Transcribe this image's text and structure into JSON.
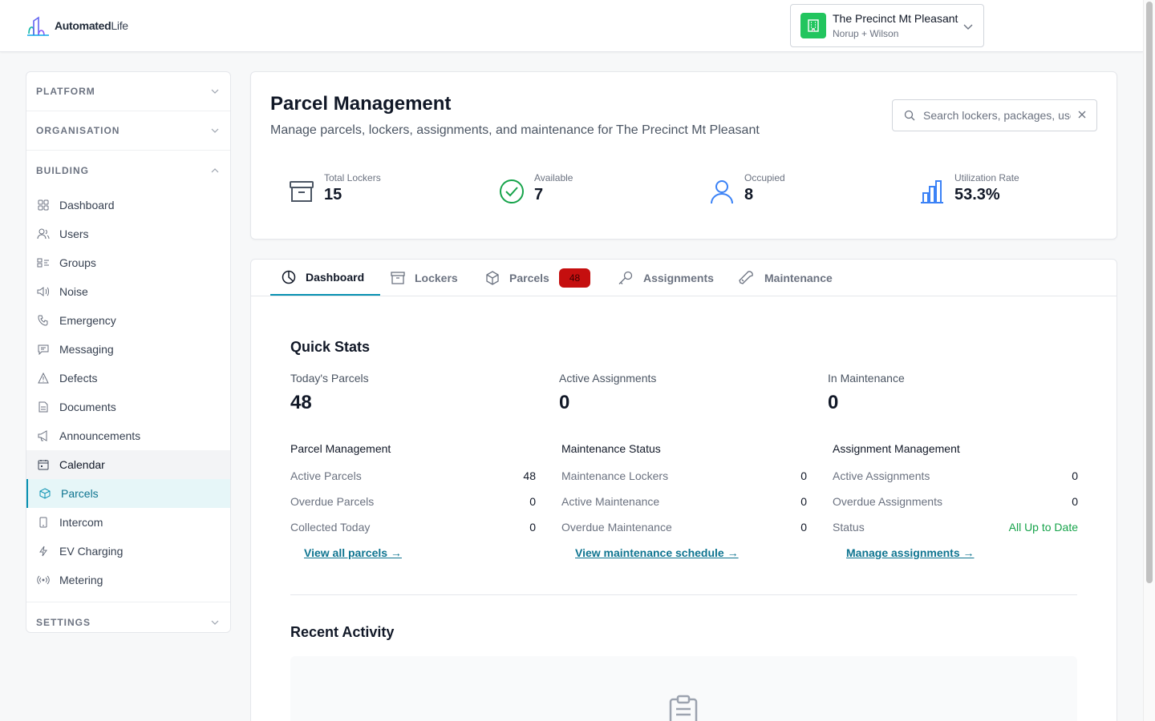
{
  "brand": {
    "logo_text_a": "Automated",
    "logo_text_b": "Life"
  },
  "building": {
    "name": "The Precinct Mt Pleasant",
    "sub": "Norup + Wilson"
  },
  "sidebar": {
    "sections": {
      "platform": "PLATFORM",
      "organisation": "ORGANISATION",
      "building": "BUILDING",
      "settings": "SETTINGS"
    },
    "items": [
      {
        "label": "Dashboard"
      },
      {
        "label": "Users"
      },
      {
        "label": "Groups"
      },
      {
        "label": "Noise"
      },
      {
        "label": "Emergency"
      },
      {
        "label": "Messaging"
      },
      {
        "label": "Defects"
      },
      {
        "label": "Documents"
      },
      {
        "label": "Announcements"
      },
      {
        "label": "Calendar"
      },
      {
        "label": "Parcels"
      },
      {
        "label": "Intercom"
      },
      {
        "label": "EV Charging"
      },
      {
        "label": "Metering"
      }
    ]
  },
  "header": {
    "title": "Parcel Management",
    "subtitle": "Manage parcels, lockers, assignments, and maintenance for The Precinct Mt Pleasant",
    "search_placeholder": "Search lockers, packages, users..."
  },
  "stats": [
    {
      "label": "Total Lockers",
      "value": "15"
    },
    {
      "label": "Available",
      "value": "7"
    },
    {
      "label": "Occupied",
      "value": "8"
    },
    {
      "label": "Utilization Rate",
      "value": "53.3%"
    }
  ],
  "tabs": [
    {
      "label": "Dashboard"
    },
    {
      "label": "Lockers"
    },
    {
      "label": "Parcels",
      "badge": "48"
    },
    {
      "label": "Assignments"
    },
    {
      "label": "Maintenance"
    }
  ],
  "quick_stats": {
    "title": "Quick Stats",
    "items": [
      {
        "label": "Today's Parcels",
        "value": "48"
      },
      {
        "label": "Active Assignments",
        "value": "0"
      },
      {
        "label": "In Maintenance",
        "value": "0"
      }
    ]
  },
  "panels": [
    {
      "title": "Parcel Management",
      "rows": [
        {
          "label": "Active Parcels",
          "value": "48"
        },
        {
          "label": "Overdue Parcels",
          "value": "0"
        },
        {
          "label": "Collected Today",
          "value": "0"
        }
      ],
      "link": "View all parcels →"
    },
    {
      "title": "Maintenance Status",
      "rows": [
        {
          "label": "Maintenance Lockers",
          "value": "0"
        },
        {
          "label": "Active Maintenance",
          "value": "0"
        },
        {
          "label": "Overdue Maintenance",
          "value": "0"
        }
      ],
      "link": "View maintenance schedule →"
    },
    {
      "title": "Assignment Management",
      "rows": [
        {
          "label": "Active Assignments",
          "value": "0"
        },
        {
          "label": "Overdue Assignments",
          "value": "0"
        },
        {
          "label": "Status",
          "value": "All Up to Date"
        }
      ],
      "link": "Manage assignments →"
    }
  ],
  "recent_activity": {
    "title": "Recent Activity"
  },
  "colors": {
    "accent": "#0891b2",
    "success": "#16a34a",
    "building_icon": "#22c55e",
    "badge": "#c50f0f",
    "stat_icon_blue": "#3b82f6"
  }
}
